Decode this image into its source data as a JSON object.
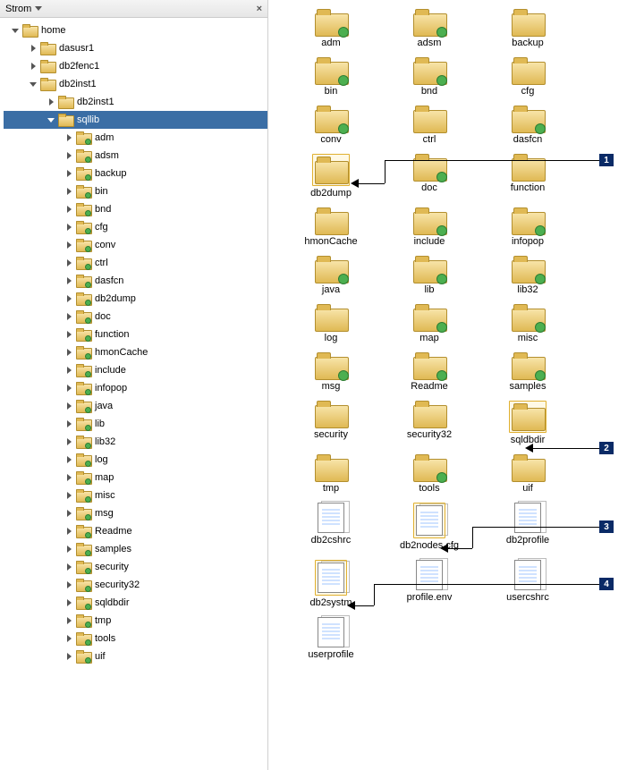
{
  "panel_title": "Strom",
  "tree": {
    "root_label": "home",
    "dasusr1": "dasusr1",
    "db2fenc1": "db2fenc1",
    "db2inst1": "db2inst1",
    "db2inst1b": "db2inst1",
    "sqllib": "sqllib",
    "children": [
      "adm",
      "adsm",
      "backup",
      "bin",
      "bnd",
      "cfg",
      "conv",
      "ctrl",
      "dasfcn",
      "db2dump",
      "doc",
      "function",
      "hmonCache",
      "include",
      "infopop",
      "java",
      "lib",
      "lib32",
      "log",
      "map",
      "misc",
      "msg",
      "Readme",
      "samples",
      "security",
      "security32",
      "sqldbdir",
      "tmp",
      "tools",
      "uif"
    ]
  },
  "grid": [
    {
      "name": "adm",
      "type": "folder",
      "link": true
    },
    {
      "name": "adsm",
      "type": "folder",
      "link": true
    },
    {
      "name": "backup",
      "type": "folder"
    },
    {
      "name": "bin",
      "type": "folder",
      "link": true
    },
    {
      "name": "bnd",
      "type": "folder",
      "link": true
    },
    {
      "name": "cfg",
      "type": "folder"
    },
    {
      "name": "conv",
      "type": "folder",
      "link": true
    },
    {
      "name": "ctrl",
      "type": "folder"
    },
    {
      "name": "dasfcn",
      "type": "folder",
      "link": true
    },
    {
      "name": "db2dump",
      "type": "folder",
      "highlight": true,
      "callout": 1
    },
    {
      "name": "doc",
      "type": "folder",
      "link": true
    },
    {
      "name": "function",
      "type": "folder"
    },
    {
      "name": "hmonCache",
      "type": "folder"
    },
    {
      "name": "include",
      "type": "folder",
      "link": true
    },
    {
      "name": "infopop",
      "type": "folder",
      "link": true
    },
    {
      "name": "java",
      "type": "folder",
      "link": true
    },
    {
      "name": "lib",
      "type": "folder",
      "link": true
    },
    {
      "name": "lib32",
      "type": "folder",
      "link": true
    },
    {
      "name": "log",
      "type": "folder"
    },
    {
      "name": "map",
      "type": "folder",
      "link": true
    },
    {
      "name": "misc",
      "type": "folder",
      "link": true
    },
    {
      "name": "msg",
      "type": "folder",
      "link": true
    },
    {
      "name": "Readme",
      "type": "folder",
      "link": true
    },
    {
      "name": "samples",
      "type": "folder",
      "link": true
    },
    {
      "name": "security",
      "type": "folder"
    },
    {
      "name": "security32",
      "type": "folder"
    },
    {
      "name": "sqldbdir",
      "type": "folder",
      "highlight": true,
      "callout": 2
    },
    {
      "name": "tmp",
      "type": "folder"
    },
    {
      "name": "tools",
      "type": "folder",
      "link": true
    },
    {
      "name": "uif",
      "type": "folder"
    },
    {
      "name": "db2cshrc",
      "type": "file"
    },
    {
      "name": "db2nodes.cfg",
      "type": "file",
      "highlight": true,
      "callout": 3
    },
    {
      "name": "db2profile",
      "type": "file"
    },
    {
      "name": "db2systm",
      "type": "file",
      "highlight": true,
      "callout": 4
    },
    {
      "name": "profile.env",
      "type": "file"
    },
    {
      "name": "usercshrc",
      "type": "file"
    },
    {
      "name": "userprofile",
      "type": "file"
    }
  ],
  "callouts": [
    "1",
    "2",
    "3",
    "4"
  ]
}
